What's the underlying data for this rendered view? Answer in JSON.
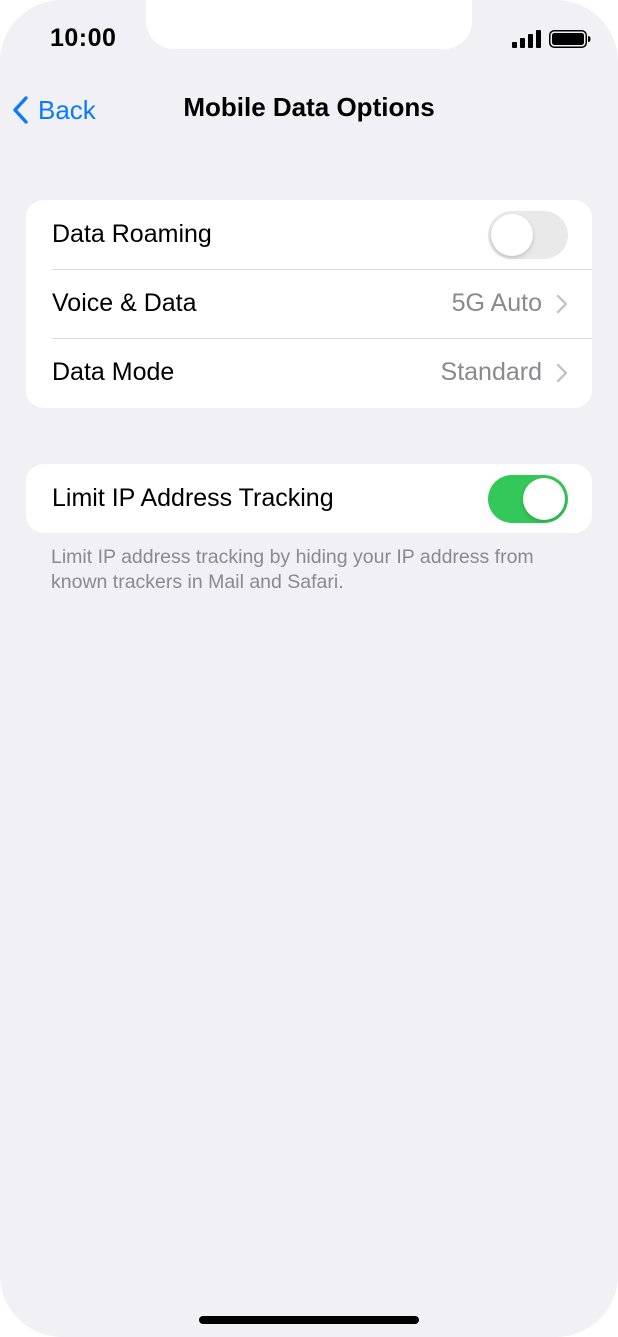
{
  "status_bar": {
    "time": "10:00",
    "signal_icon": "cellular-signal-icon",
    "battery_icon": "battery-full-icon"
  },
  "nav": {
    "back_label": "Back",
    "back_icon": "chevron-left-icon",
    "title": "Mobile Data Options"
  },
  "settings_group_1": {
    "rows": [
      {
        "label": "Data Roaming",
        "control": "toggle",
        "enabled": false
      },
      {
        "label": "Voice & Data",
        "value": "5G Auto",
        "control": "disclosure"
      },
      {
        "label": "Data Mode",
        "value": "Standard",
        "control": "disclosure"
      }
    ]
  },
  "settings_group_2": {
    "rows": [
      {
        "label": "Limit IP Address Tracking",
        "control": "toggle",
        "enabled": true
      }
    ],
    "footnote": "Limit IP address tracking by hiding your IP address from known trackers in Mail and Safari."
  },
  "colors": {
    "accent": "#0a7aff",
    "toggle_on": "#34c759",
    "toggle_off": "#e9e9ea",
    "background": "#f0f0f5",
    "secondary_text": "#8a8a8e"
  }
}
